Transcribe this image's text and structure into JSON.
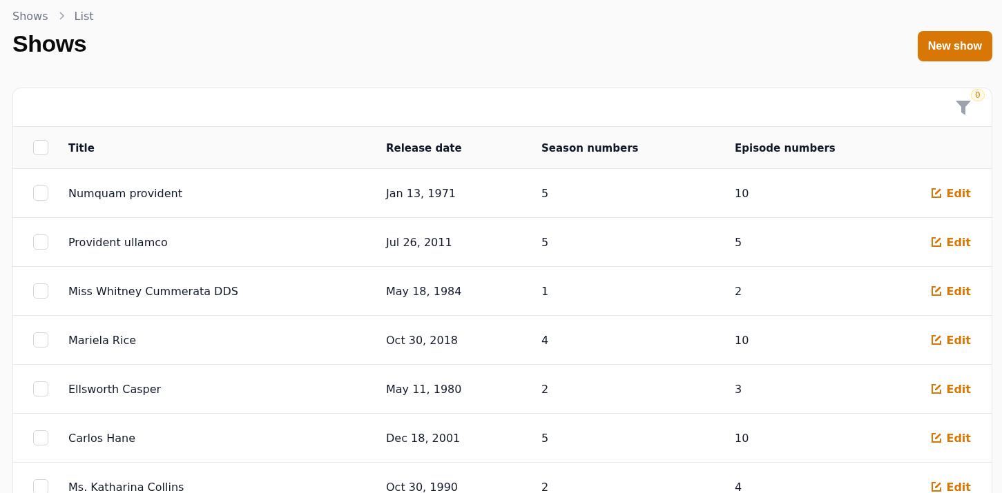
{
  "breadcrumbs": [
    "Shows",
    "List"
  ],
  "title": "Shows",
  "new_button": "New show",
  "filter_badge": "0",
  "table": {
    "select_all": {
      "checked": false
    },
    "columns": [
      "Title",
      "Release date",
      "Season numbers",
      "Episode numbers"
    ],
    "rows": [
      {
        "checked": false,
        "title": "Numquam provident",
        "release_date": "Jan 13, 1971",
        "season_numbers": "5",
        "episode_numbers": "10",
        "action": "Edit"
      },
      {
        "checked": false,
        "title": "Provident ullamco",
        "release_date": "Jul 26, 2011",
        "season_numbers": "5",
        "episode_numbers": "5",
        "action": "Edit"
      },
      {
        "checked": false,
        "title": "Miss Whitney Cummerata DDS",
        "release_date": "May 18, 1984",
        "season_numbers": "1",
        "episode_numbers": "2",
        "action": "Edit"
      },
      {
        "checked": false,
        "title": "Mariela Rice",
        "release_date": "Oct 30, 2018",
        "season_numbers": "4",
        "episode_numbers": "10",
        "action": "Edit"
      },
      {
        "checked": false,
        "title": "Ellsworth Casper",
        "release_date": "May 11, 1980",
        "season_numbers": "2",
        "episode_numbers": "3",
        "action": "Edit"
      },
      {
        "checked": false,
        "title": "Carlos Hane",
        "release_date": "Dec 18, 2001",
        "season_numbers": "5",
        "episode_numbers": "10",
        "action": "Edit"
      },
      {
        "checked": false,
        "title": "Ms. Katharina Collins",
        "release_date": "Oct 30, 1990",
        "season_numbers": "2",
        "episode_numbers": "4",
        "action": "Edit"
      }
    ]
  }
}
